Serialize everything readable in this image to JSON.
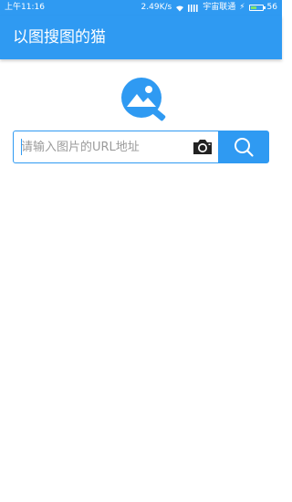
{
  "status_bar": {
    "time": "上午11:16",
    "speed": "2.49K/s",
    "carrier": "宇宙联通",
    "battery": "56",
    "battery_level": 0.56,
    "icons": [
      "wifi-icon",
      "signal-bars-icon",
      "charging-bolt-icon",
      "battery-icon"
    ]
  },
  "app_bar": {
    "title": "以图搜图的猫"
  },
  "logo": {
    "icon": "image-search-logo-icon",
    "color": "#2f9af2"
  },
  "search": {
    "placeholder": "请输入图片的URL地址",
    "value": "",
    "camera_icon": "camera-icon",
    "submit_icon": "search-icon"
  },
  "colors": {
    "accent": "#2f9af2",
    "background": "#ffffff"
  }
}
